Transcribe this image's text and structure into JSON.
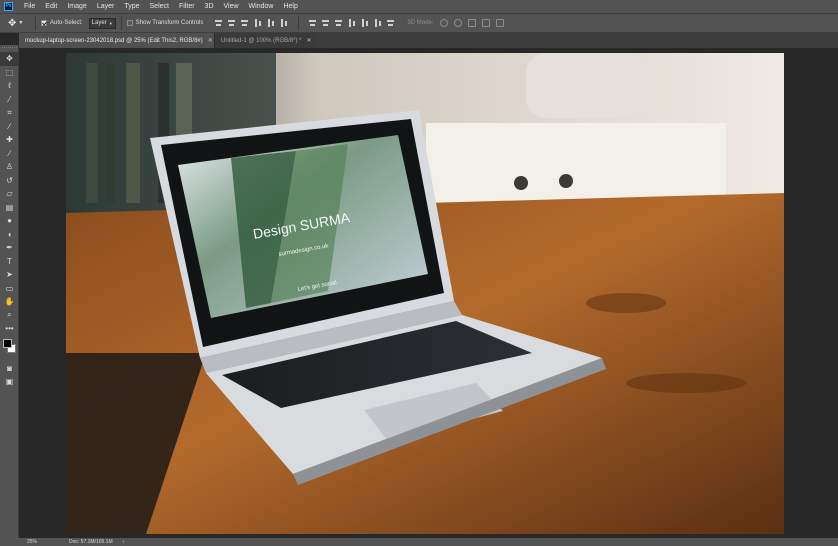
{
  "app": {
    "logo": "Ps"
  },
  "menu": [
    "File",
    "Edit",
    "Image",
    "Layer",
    "Type",
    "Select",
    "Filter",
    "3D",
    "View",
    "Window",
    "Help"
  ],
  "options": {
    "auto_select_label": "Auto-Select:",
    "auto_select_checked": true,
    "target_value": "Layer",
    "transform_label": "Show Transform Controls",
    "transform_checked": false,
    "mode_3d_label": "3D Mode:"
  },
  "tabs": [
    {
      "label": "mockup-laptop-screen-23042018.psd @ 25% (Edit This2, RGB/8#)",
      "active": true
    },
    {
      "label": "Untitled-1 @ 100% (RGB/8*) *",
      "active": false
    }
  ],
  "tools": [
    "move-icon",
    "marquee-icon",
    "lasso-icon",
    "magic-wand-icon",
    "crop-icon",
    "eyedropper-icon",
    "healing-icon",
    "brush-icon",
    "stamp-icon",
    "history-brush-icon",
    "eraser-icon",
    "gradient-icon",
    "blur-icon",
    "dodge-icon",
    "pen-icon",
    "type-icon",
    "path-select-icon",
    "rectangle-icon",
    "hand-icon",
    "zoom-icon"
  ],
  "colors": {
    "foreground": "#000000",
    "background": "#ffffff",
    "accent": "#31a8ff"
  },
  "laptop_screen": {
    "brand_prefix": "Design",
    "brand": "SURMA",
    "url": "surmadesign.co.uk",
    "tagline": "Let's get social"
  },
  "status": {
    "zoom": "25%",
    "doc": "Doc: 57.1M/105.1M",
    "arrow": "›"
  }
}
